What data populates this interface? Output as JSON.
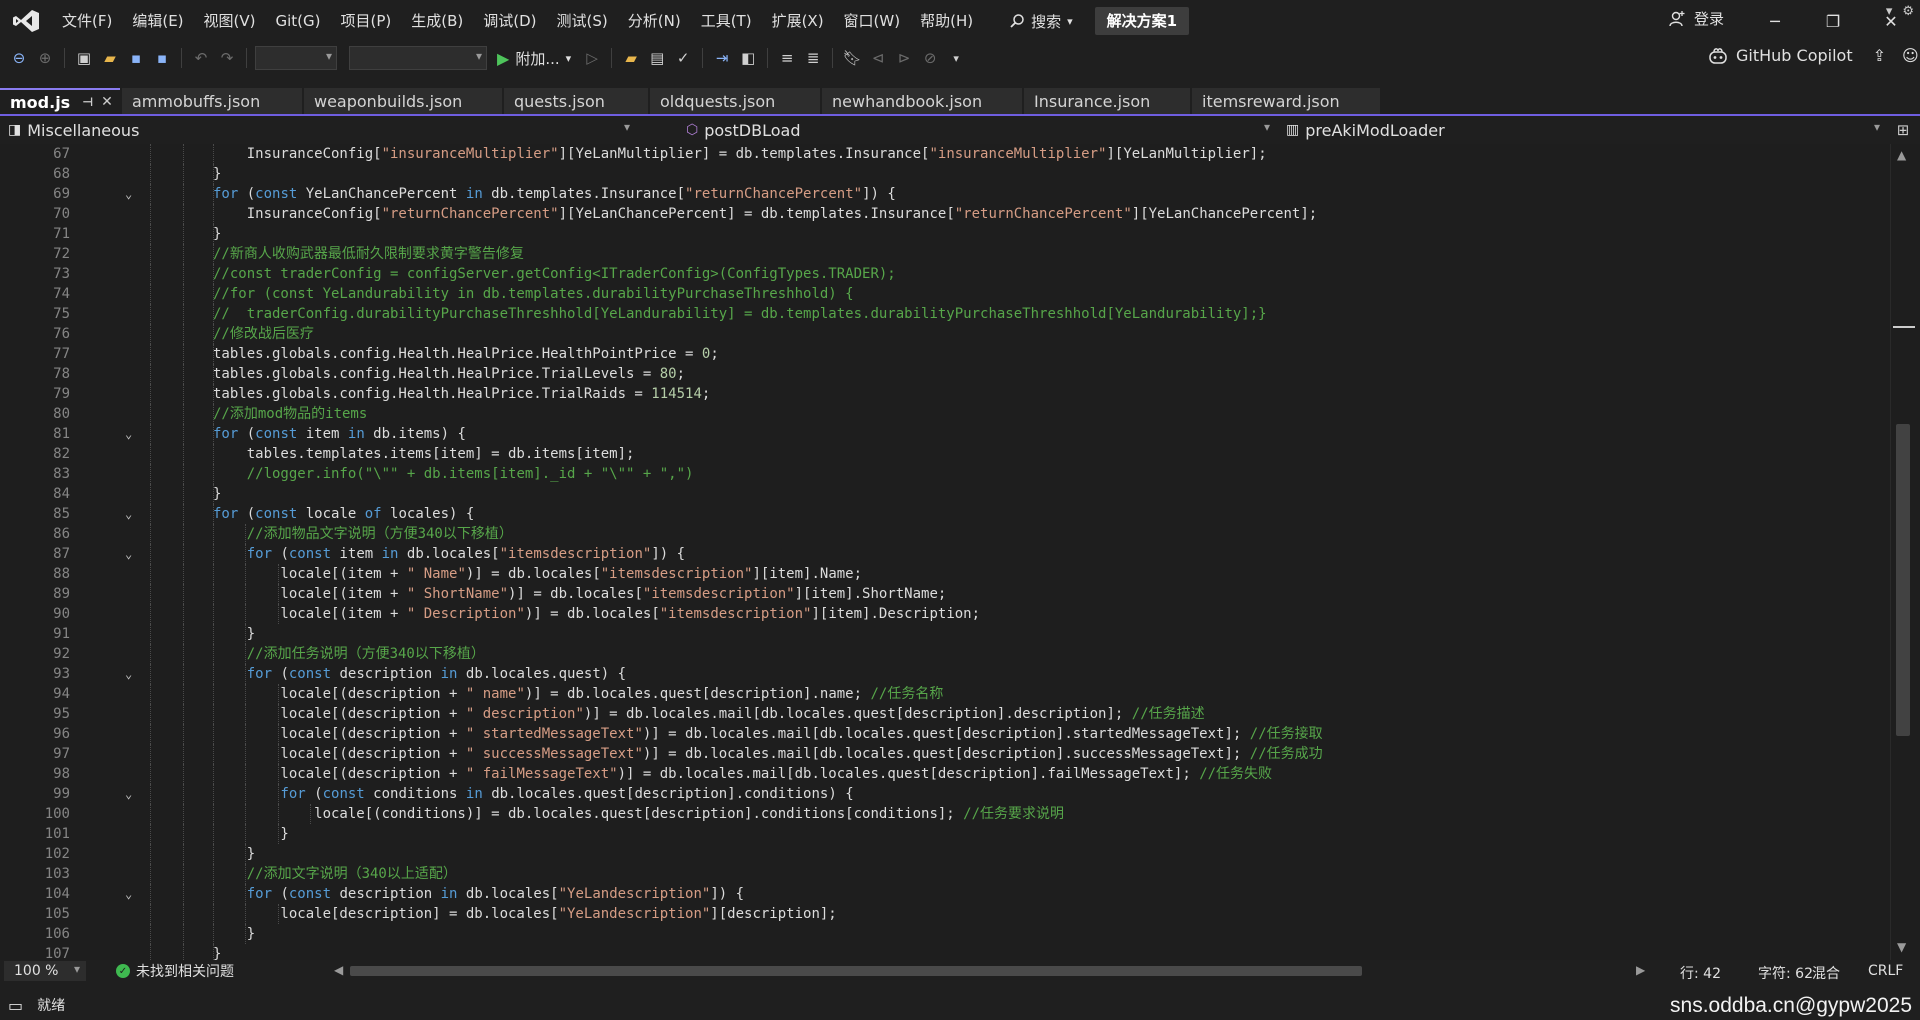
{
  "menu": [
    "文件(F)",
    "编辑(E)",
    "视图(V)",
    "Git(G)",
    "项目(P)",
    "生成(B)",
    "调试(D)",
    "测试(S)",
    "分析(N)",
    "工具(T)",
    "扩展(X)",
    "窗口(W)",
    "帮助(H)"
  ],
  "search_label": "搜索",
  "solution_name": "解决方案1",
  "login_label": "登录",
  "toolbar": {
    "attach_label": "附加...",
    "copilot_label": "GitHub Copilot"
  },
  "tabs": [
    {
      "label": "mod.js",
      "active": true
    },
    {
      "label": "ammobuffs.json"
    },
    {
      "label": "weaponbuilds.json"
    },
    {
      "label": "quests.json"
    },
    {
      "label": "oldquests.json"
    },
    {
      "label": "newhandbook.json"
    },
    {
      "label": "Insurance.json"
    },
    {
      "label": "itemsreward.json"
    }
  ],
  "navbar": {
    "project": "Miscellaneous",
    "member": "postDBLoad",
    "scope": "preAkiModLoader"
  },
  "code_lines": [
    {
      "n": "67",
      "d": 3,
      "t": "    InsuranceConfig[\"insuranceMultiplier\"][YeLanMultiplier] = db.templates.Insurance[\"insuranceMultiplier\"][YeLanMultiplier];"
    },
    {
      "n": "68",
      "d": 3,
      "t": "}"
    },
    {
      "n": "69",
      "d": 3,
      "f": true,
      "t": "for (const YeLanChancePercent in db.templates.Insurance[\"returnChancePercent\"]) {"
    },
    {
      "n": "70",
      "d": 3,
      "t": "    InsuranceConfig[\"returnChancePercent\"][YeLanChancePercent] = db.templates.Insurance[\"returnChancePercent\"][YeLanChancePercent];"
    },
    {
      "n": "71",
      "d": 3,
      "t": "}"
    },
    {
      "n": "72",
      "d": 3,
      "t": "//新商人收购武器最低耐久限制要求黄字警告修复"
    },
    {
      "n": "73",
      "d": 3,
      "t": "//const traderConfig = configServer.getConfig<ITraderConfig>(ConfigTypes.TRADER);"
    },
    {
      "n": "74",
      "d": 3,
      "t": "//for (const YeLandurability in db.templates.durabilityPurchaseThreshhold) {"
    },
    {
      "n": "75",
      "d": 3,
      "t": "//  traderConfig.durabilityPurchaseThreshhold[YeLandurability] = db.templates.durabilityPurchaseThreshhold[YeLandurability];}"
    },
    {
      "n": "76",
      "d": 3,
      "t": "//修改战后医疗"
    },
    {
      "n": "77",
      "d": 3,
      "t": "tables.globals.config.Health.HealPrice.HealthPointPrice = 0;"
    },
    {
      "n": "78",
      "d": 3,
      "t": "tables.globals.config.Health.HealPrice.TrialLevels = 80;"
    },
    {
      "n": "79",
      "d": 3,
      "t": "tables.globals.config.Health.HealPrice.TrialRaids = 114514;"
    },
    {
      "n": "80",
      "d": 3,
      "t": "//添加mod物品的items"
    },
    {
      "n": "81",
      "d": 3,
      "f": true,
      "t": "for (const item in db.items) {"
    },
    {
      "n": "82",
      "d": 3,
      "t": "    tables.templates.items[item] = db.items[item];"
    },
    {
      "n": "83",
      "d": 3,
      "t": "    //logger.info(\"\\\"\" + db.items[item]._id + \"\\\"\" + \",\")"
    },
    {
      "n": "84",
      "d": 3,
      "t": "}"
    },
    {
      "n": "85",
      "d": 3,
      "f": true,
      "t": "for (const locale of locales) {"
    },
    {
      "n": "86",
      "d": 4,
      "t": "    //添加物品文字说明（方便340以下移植）"
    },
    {
      "n": "87",
      "d": 4,
      "f": true,
      "t": "    for (const item in db.locales[\"itemsdescription\"]) {"
    },
    {
      "n": "88",
      "d": 5,
      "t": "        locale[(item + \" Name\")] = db.locales[\"itemsdescription\"][item].Name;"
    },
    {
      "n": "89",
      "d": 5,
      "t": "        locale[(item + \" ShortName\")] = db.locales[\"itemsdescription\"][item].ShortName;"
    },
    {
      "n": "90",
      "d": 5,
      "t": "        locale[(item + \" Description\")] = db.locales[\"itemsdescription\"][item].Description;"
    },
    {
      "n": "91",
      "d": 4,
      "t": "    }"
    },
    {
      "n": "92",
      "d": 4,
      "t": "    //添加任务说明（方便340以下移植）"
    },
    {
      "n": "93",
      "d": 4,
      "f": true,
      "t": "    for (const description in db.locales.quest) {"
    },
    {
      "n": "94",
      "d": 5,
      "t": "        locale[(description + \" name\")] = db.locales.quest[description].name; //任务名称"
    },
    {
      "n": "95",
      "d": 5,
      "t": "        locale[(description + \" description\")] = db.locales.mail[db.locales.quest[description].description]; //任务描述"
    },
    {
      "n": "96",
      "d": 5,
      "t": "        locale[(description + \" startedMessageText\")] = db.locales.mail[db.locales.quest[description].startedMessageText]; //任务接取"
    },
    {
      "n": "97",
      "d": 5,
      "t": "        locale[(description + \" successMessageText\")] = db.locales.mail[db.locales.quest[description].successMessageText]; //任务成功"
    },
    {
      "n": "98",
      "d": 5,
      "t": "        locale[(description + \" failMessageText\")] = db.locales.mail[db.locales.quest[description].failMessageText]; //任务失败"
    },
    {
      "n": "99",
      "d": 5,
      "f": true,
      "t": "        for (const conditions in db.locales.quest[description].conditions) {"
    },
    {
      "n": "100",
      "d": 6,
      "t": "            locale[(conditions)] = db.locales.quest[description].conditions[conditions]; //任务要求说明"
    },
    {
      "n": "101",
      "d": 5,
      "t": "        }"
    },
    {
      "n": "102",
      "d": 4,
      "t": "    }"
    },
    {
      "n": "103",
      "d": 4,
      "t": "    //添加文字说明（340以上适配）"
    },
    {
      "n": "104",
      "d": 4,
      "f": true,
      "t": "    for (const description in db.locales[\"YeLandescription\"]) {"
    },
    {
      "n": "105",
      "d": 5,
      "t": "        locale[description] = db.locales[\"YeLandescription\"][description];"
    },
    {
      "n": "106",
      "d": 4,
      "t": "    }"
    },
    {
      "n": "107",
      "d": 3,
      "t": "}"
    }
  ],
  "editor_status": {
    "zoom": "100 %",
    "issues": "未找到相关问题",
    "line": "行: 42",
    "char": "字符: 62",
    "mixed": "混合",
    "eol": "CRLF"
  },
  "status": {
    "ready": "就绪"
  },
  "watermark": "sns.oddba.cn@gypw2025"
}
